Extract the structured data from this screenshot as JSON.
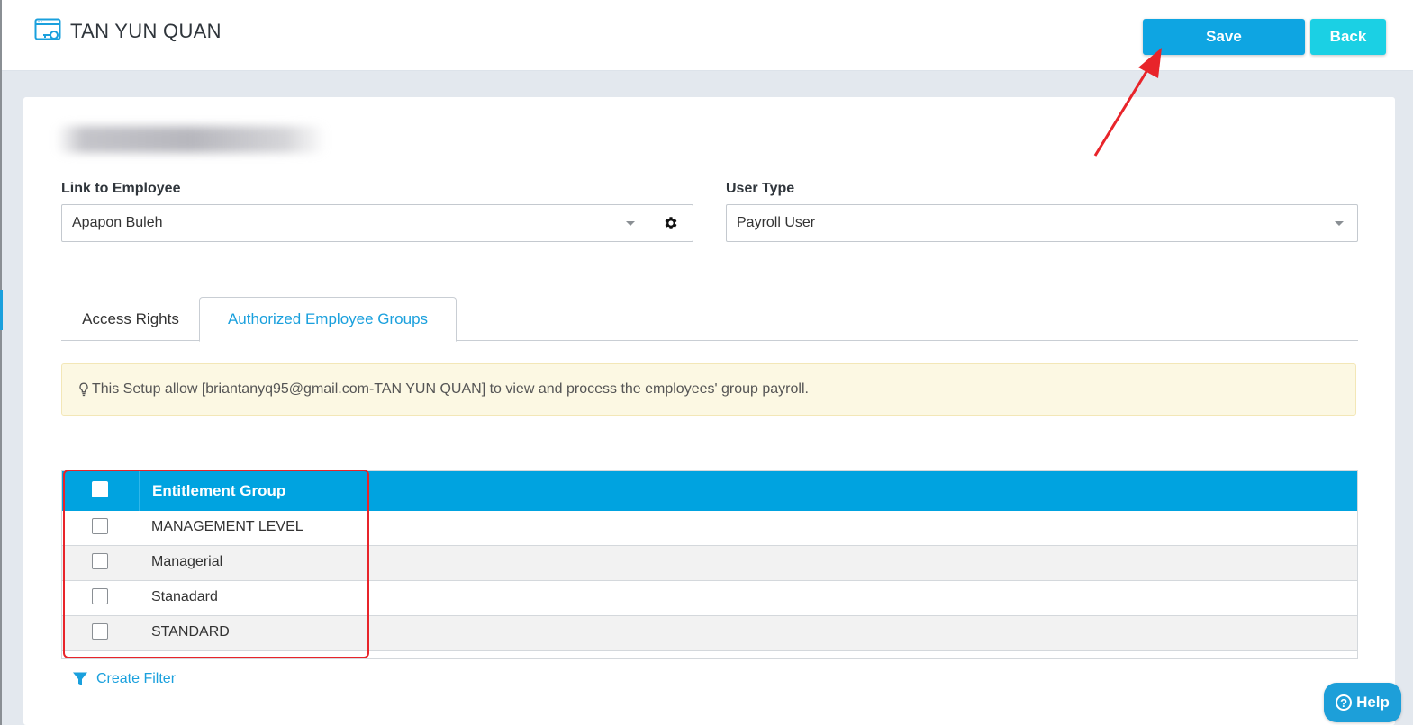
{
  "header": {
    "title": "TAN YUN QUAN",
    "icon": "user-key-icon",
    "save_label": "Save",
    "back_label": "Back"
  },
  "form": {
    "link_to_employee": {
      "label": "Link to Employee",
      "value": "Apapon Buleh"
    },
    "user_type": {
      "label": "User Type",
      "value": "Payroll User"
    }
  },
  "tabs": [
    {
      "label": "Access Rights",
      "active": false
    },
    {
      "label": "Authorized Employee Groups",
      "active": true
    }
  ],
  "notice": {
    "text": "This Setup allow [briantanyq95@gmail.com-TAN YUN QUAN] to view and process the employees' group payroll."
  },
  "grid": {
    "column_header": "Entitlement Group",
    "rows": [
      {
        "label": "MANAGEMENT LEVEL",
        "checked": false
      },
      {
        "label": "Managerial",
        "checked": false
      },
      {
        "label": "Stanadard",
        "checked": false
      },
      {
        "label": "STANDARD",
        "checked": false
      }
    ]
  },
  "filter": {
    "label": "Create Filter"
  },
  "help": {
    "label": "Help"
  },
  "colors": {
    "primary": "#0ea5e2",
    "back_button": "#1bd0e4",
    "grid_header": "#00a3e0",
    "notice_bg": "#fcf8e3",
    "annotation": "#e8242a"
  }
}
